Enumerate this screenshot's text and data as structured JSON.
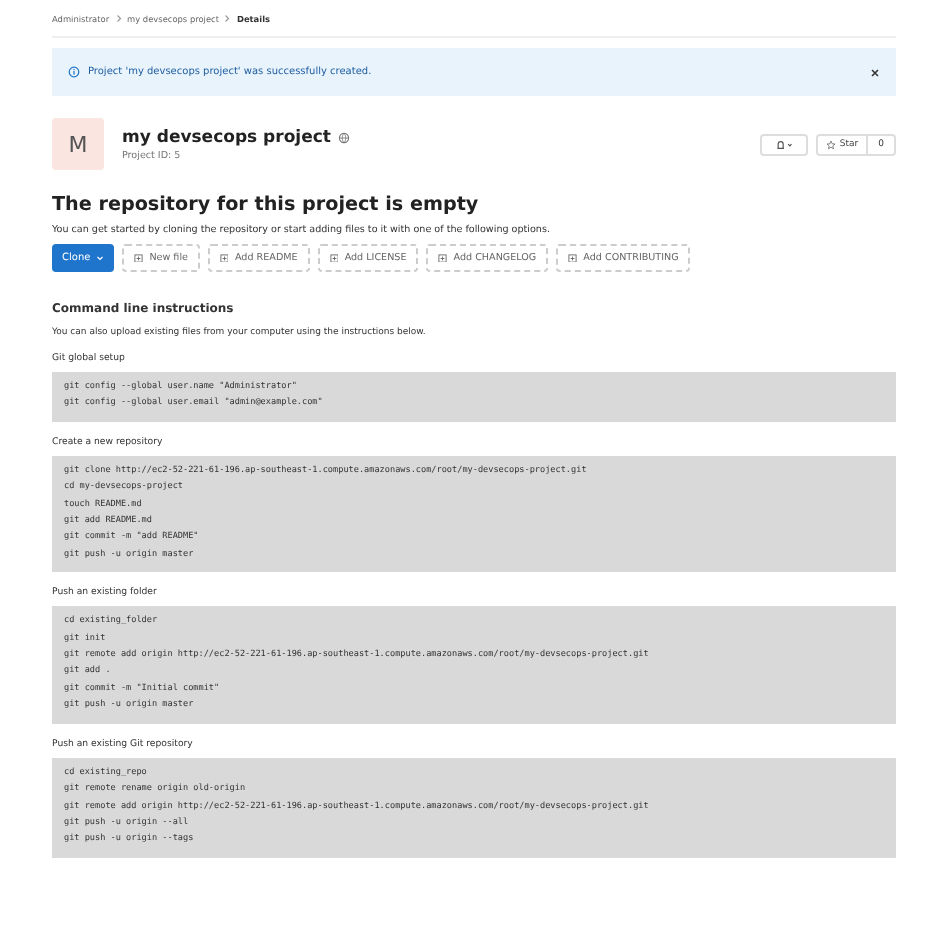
{
  "breadcrumbs": [
    "Administrator",
    "my devsecops project",
    "Details"
  ],
  "alert": {
    "message": "Project 'my devsecops project' was successfully created."
  },
  "project": {
    "avatar_letter": "M",
    "name": "my devsecops project",
    "id_text": "Project ID: 5",
    "star_label": "Star",
    "star_count": "0"
  },
  "empty_state": {
    "title": "The repository for this project is empty",
    "description": "You can get started by cloning the repository or start adding files to it with one of the following options."
  },
  "actions": [
    {
      "label": "Clone",
      "kind": "dropdown"
    },
    {
      "label": "New file",
      "kind": "add"
    },
    {
      "label": "Add README",
      "kind": "add"
    },
    {
      "label": "Add LICENSE",
      "kind": "add"
    },
    {
      "label": "Add CHANGELOG",
      "kind": "add"
    },
    {
      "label": "Add CONTRIBUTING",
      "kind": "add"
    }
  ],
  "cli": {
    "title": "Command line instructions",
    "description": "You can also upload existing files from your computer using the instructions below.",
    "sections": [
      {
        "title": "Git global setup",
        "lines": [
          "git config --global user.name \"Administrator\"",
          "git config --global user.email \"admin@example.com\""
        ]
      },
      {
        "title": "Create a new repository",
        "lines": [
          "git clone http://ec2-52-221-61-196.ap-southeast-1.compute.amazonaws.com/root/my-devsecops-project.git",
          "cd my-devsecops-project",
          "touch README.md",
          "git add README.md",
          "git commit -m \"add README\"",
          "git push -u origin master"
        ]
      },
      {
        "title": "Push an existing folder",
        "lines": [
          "cd existing_folder",
          "git init",
          "git remote add origin http://ec2-52-221-61-196.ap-southeast-1.compute.amazonaws.com/root/my-devsecops-project.git",
          "git add .",
          "git commit -m \"Initial commit\"",
          "git push -u origin master"
        ]
      },
      {
        "title": "Push an existing Git repository",
        "lines": [
          "cd existing_repo",
          "git remote rename origin old-origin",
          "git remote add origin http://ec2-52-221-61-196.ap-southeast-1.compute.amazonaws.com/root/my-devsecops-project.git",
          "git push -u origin --all",
          "git push -u origin --tags"
        ]
      }
    ]
  }
}
